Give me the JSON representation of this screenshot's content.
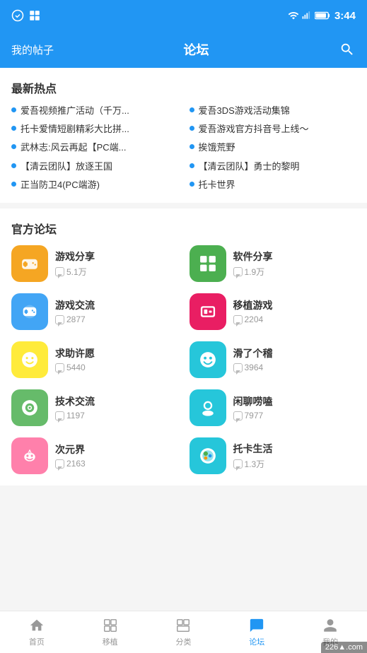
{
  "statusBar": {
    "time": "3:44",
    "icons": [
      "signal",
      "wifi",
      "battery"
    ]
  },
  "header": {
    "leftLabel": "我的帖子",
    "title": "论坛",
    "searchIcon": "search"
  },
  "hotSection": {
    "title": "最新热点",
    "items": [
      "爱吾视频推广活动（千万...",
      "爱吾3DS游戏活动集锦",
      "托卡爱情短剧精彩大比拼...",
      "爱吾游戏官方抖音号上线～",
      "武林志:风云再起【PC端...",
      "挨饿荒野",
      "【清云团队】放逐王国",
      "【清云团队】勇士的黎明",
      "正当防卫4(PC端游)",
      "托卡世界"
    ]
  },
  "forumSection": {
    "title": "官方论坛",
    "items": [
      {
        "name": "游戏分享",
        "count": "5.1万",
        "color": "#F5A623",
        "emoji": "🎮"
      },
      {
        "name": "软件分享",
        "count": "1.9万",
        "color": "#4CAF50",
        "emoji": "⊞"
      },
      {
        "name": "游戏交流",
        "count": "2877",
        "color": "#2196F3",
        "emoji": "🎮"
      },
      {
        "name": "移植游戏",
        "count": "2204",
        "color": "#E91E63",
        "emoji": "🎮"
      },
      {
        "name": "求助许愿",
        "count": "5440",
        "color": "#FFEB3B",
        "emoji": "😊"
      },
      {
        "name": "滑了个稽",
        "count": "3964",
        "color": "#26C6DA",
        "emoji": "😄"
      },
      {
        "name": "技术交流",
        "count": "1197",
        "color": "#4CAF50",
        "emoji": "🟡"
      },
      {
        "name": "闲聊唠嗑",
        "count": "7977",
        "color": "#00BCD4",
        "emoji": "👤"
      },
      {
        "name": "次元界",
        "count": "2163",
        "color": "#FF80AB",
        "emoji": "🦊"
      },
      {
        "name": "托卡生活",
        "count": "1.3万",
        "color": "#26C6DA",
        "emoji": "🌍"
      }
    ]
  },
  "bottomNav": {
    "items": [
      {
        "label": "首页",
        "icon": "home",
        "active": false
      },
      {
        "label": "移植",
        "icon": "transplant",
        "active": false
      },
      {
        "label": "分类",
        "icon": "category",
        "active": false
      },
      {
        "label": "论坛",
        "icon": "forum",
        "active": true
      },
      {
        "label": "我的",
        "icon": "user",
        "active": false
      }
    ]
  },
  "watermark": {
    "text": "2265 Con",
    "site": "226▲.com"
  }
}
